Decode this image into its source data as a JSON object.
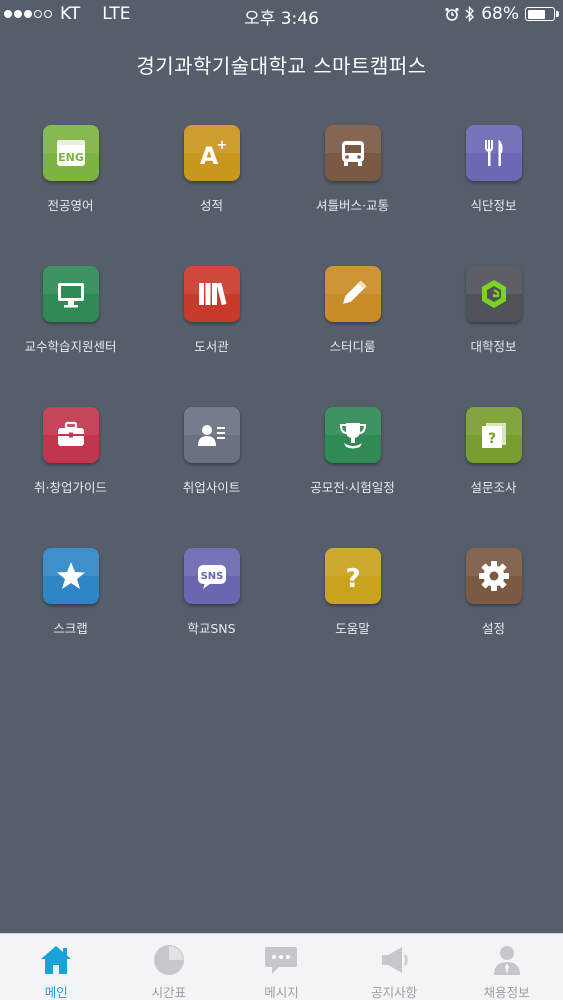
{
  "status_bar": {
    "carrier": "KT",
    "network": "LTE",
    "time": "오후 3:46",
    "battery": "68%",
    "battery_level": 0.68
  },
  "app": {
    "title": "경기과학기술대학교 스마트캠퍼스"
  },
  "menu": [
    {
      "label": "전공영어",
      "icon": "eng-icon",
      "color": "#7cb342"
    },
    {
      "label": "성적",
      "icon": "grade-a-plus-icon",
      "color": "#c9961e"
    },
    {
      "label": "셔틀버스·교통",
      "icon": "bus-icon",
      "color": "#7b5a44"
    },
    {
      "label": "식단정보",
      "icon": "fork-knife-icon",
      "color": "#6c68b4"
    },
    {
      "label": "교수학습지원센터",
      "icon": "monitor-icon",
      "color": "#2f8a55"
    },
    {
      "label": "도서관",
      "icon": "books-icon",
      "color": "#c83a2c"
    },
    {
      "label": "스터디룸",
      "icon": "pencil-icon",
      "color": "#c98d27"
    },
    {
      "label": "대학정보",
      "icon": "university-logo-icon",
      "color": "#4f5359"
    },
    {
      "label": "취·창업가이드",
      "icon": "briefcase-icon",
      "color": "#c2364d"
    },
    {
      "label": "취업사이트",
      "icon": "profile-card-icon",
      "color": "#6a7283"
    },
    {
      "label": "공모전·시험일정",
      "icon": "trophy-icon",
      "color": "#2f8a55"
    },
    {
      "label": "설문조사",
      "icon": "survey-icon",
      "color": "#7a9e2d"
    },
    {
      "label": "스크랩",
      "icon": "star-icon",
      "color": "#2f86c6"
    },
    {
      "label": "학교SNS",
      "icon": "sns-icon",
      "color": "#6a66b0"
    },
    {
      "label": "도움말",
      "icon": "question-icon",
      "color": "#c9a21e"
    },
    {
      "label": "설정",
      "icon": "gear-icon",
      "color": "#7b5a44"
    }
  ],
  "tabbar": {
    "active_color": "#1aa1d8",
    "inactive_color": "#c4c7cc",
    "tabs": [
      {
        "label": "메인",
        "icon": "home-icon"
      },
      {
        "label": "시간표",
        "icon": "clock-icon"
      },
      {
        "label": "메시지",
        "icon": "chat-icon"
      },
      {
        "label": "공지사항",
        "icon": "megaphone-icon"
      },
      {
        "label": "채용정보",
        "icon": "person-icon"
      }
    ]
  }
}
